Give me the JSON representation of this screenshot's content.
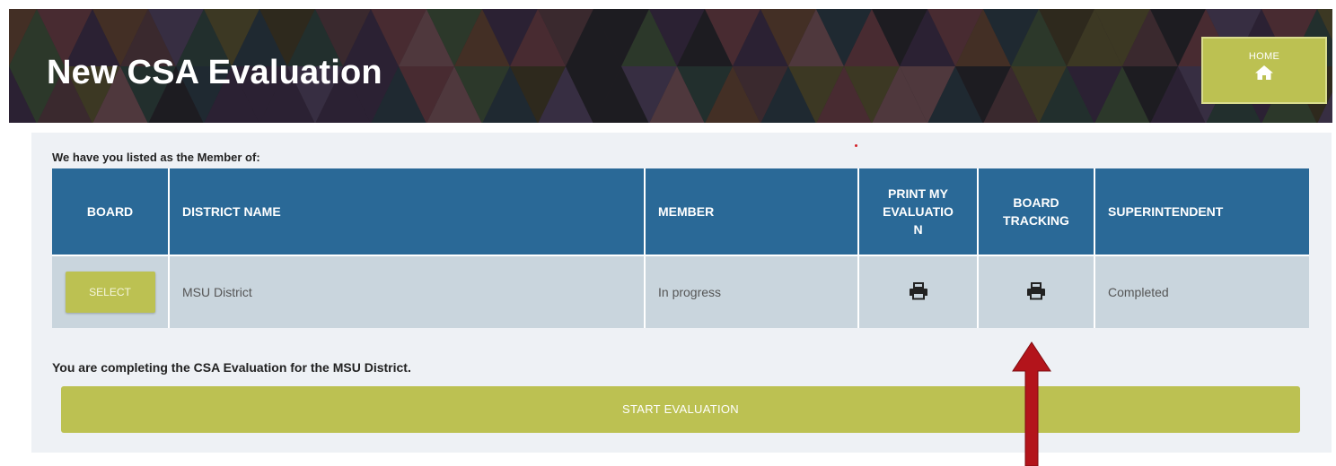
{
  "header": {
    "title": "New CSA Evaluation",
    "home_label": "HOME",
    "home_icon": "home-icon"
  },
  "panel": {
    "listed_text": "We have you listed as the Member of:",
    "table": {
      "headers": {
        "board": "BOARD",
        "district_name": "DISTRICT NAME",
        "member": "MEMBER",
        "print_line1": "PRINT MY",
        "print_line2": "EVALUATIO",
        "print_line3": "N",
        "tracking_line1": "BOARD",
        "tracking_line2": "TRACKING",
        "superintendent": "SUPERINTENDENT"
      },
      "rows": [
        {
          "select_label": "SELECT",
          "district_name": "MSU District",
          "member_status": "In progress",
          "print_icon": "printer-icon",
          "tracking_icon": "printer-icon",
          "superintendent_status": "Completed"
        }
      ]
    },
    "completing_text": "You are completing the CSA Evaluation for the MSU District.",
    "start_label": "START EVALUATION"
  },
  "colors": {
    "header_bg": "#2a6997",
    "button_bg": "#bcc152",
    "row_bg": "#c9d5dd",
    "panel_bg": "#eef1f5",
    "arrow": "#b3141b"
  }
}
